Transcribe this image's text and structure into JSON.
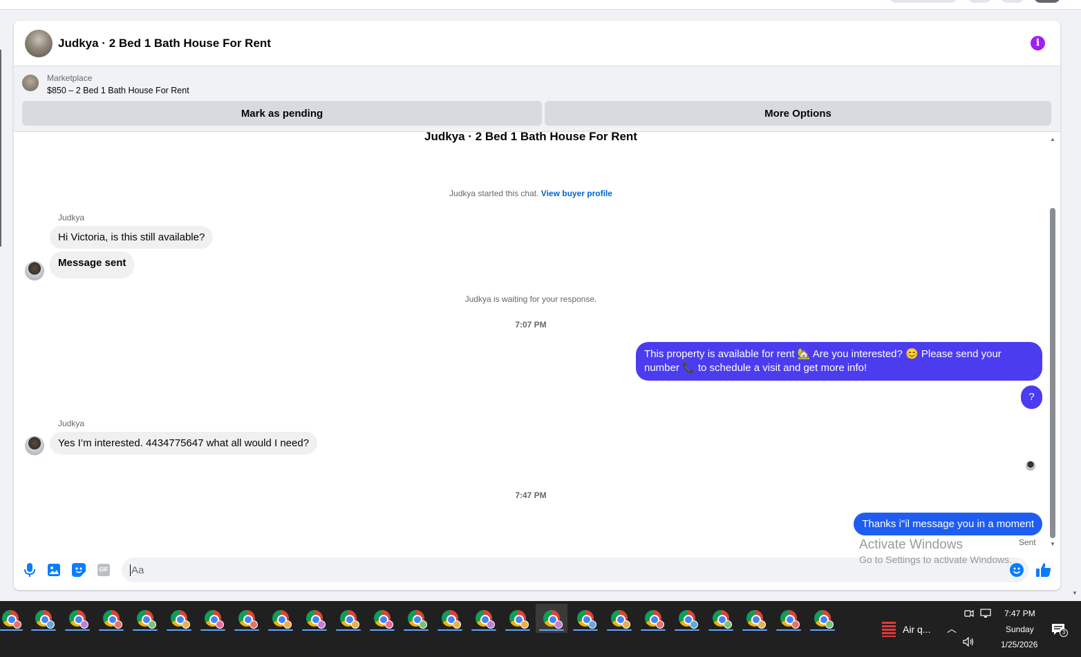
{
  "chat_header": {
    "title": "Judkya · 2 Bed 1 Bath House For Rent",
    "info_icon": "info-icon",
    "info_color": "#a020f0"
  },
  "marketplace": {
    "label": "Marketplace",
    "item": "$850 – 2 Bed 1 Bath House For Rent",
    "buttons": {
      "mark_pending": "Mark as pending",
      "more_options": "More Options"
    }
  },
  "conversation": {
    "title": "Judkya · 2 Bed 1 Bath House For Rent",
    "started_note": "Judkya started this chat.",
    "view_profile": "View buyer profile",
    "sender_1": "Judkya",
    "msg_1": "Hi Victoria, is this still available?",
    "msg_2": "Message sent",
    "waiting_note": "Judkya is waiting for your response.",
    "time_1": "7:07 PM",
    "out_msg_1": "This property is available for rent 🏡 Are you interested? 😊 Please send your number 📞 to schedule a visit and get more info!",
    "out_msg_2": "?",
    "sender_2": "Judkya",
    "msg_3": "Yes I’m interested. 4434775647 what all would I need?",
    "time_2": "7:47 PM",
    "out_msg_3": "Thanks i\"il message you in a moment",
    "status": "Sent",
    "outgoing_color": "#4b3cf0",
    "outgoing_latest_color": "#1f5df0"
  },
  "composer": {
    "placeholder": "Aa",
    "icons": [
      "microphone-icon",
      "photo-icon",
      "sticker-icon",
      "gif-icon",
      "emoji-icon",
      "thumbs-up-icon"
    ],
    "gif_label": "GIF",
    "accent_color": "#0a7cff"
  },
  "watermark": {
    "line1": "Activate Windows",
    "line2": "Go to Settings to activate Windows."
  },
  "taskbar": {
    "weather": "Air q...",
    "time": "7:47 PM",
    "day": "Sunday",
    "date": "1/25/2026",
    "notification_count": "3"
  }
}
